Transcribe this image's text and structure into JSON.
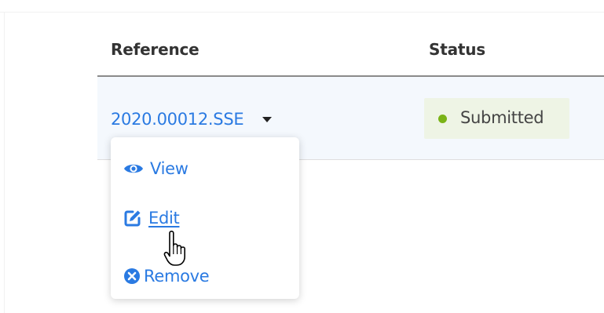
{
  "table": {
    "columns": {
      "reference": "Reference",
      "status": "Status"
    },
    "rows": [
      {
        "reference": "2020.00012.SSE",
        "status": "Submitted"
      }
    ]
  },
  "dropdown_menu": {
    "items": [
      {
        "label": "View",
        "icon": "eye-icon"
      },
      {
        "label": "Edit",
        "icon": "edit-icon"
      },
      {
        "label": "Remove",
        "icon": "remove-circle-icon"
      }
    ]
  },
  "colors": {
    "link": "#2a7ae2",
    "status_dot": "#7ab317",
    "status_badge_bg": "#eef4e5",
    "row_bg": "#f4f8fd"
  }
}
